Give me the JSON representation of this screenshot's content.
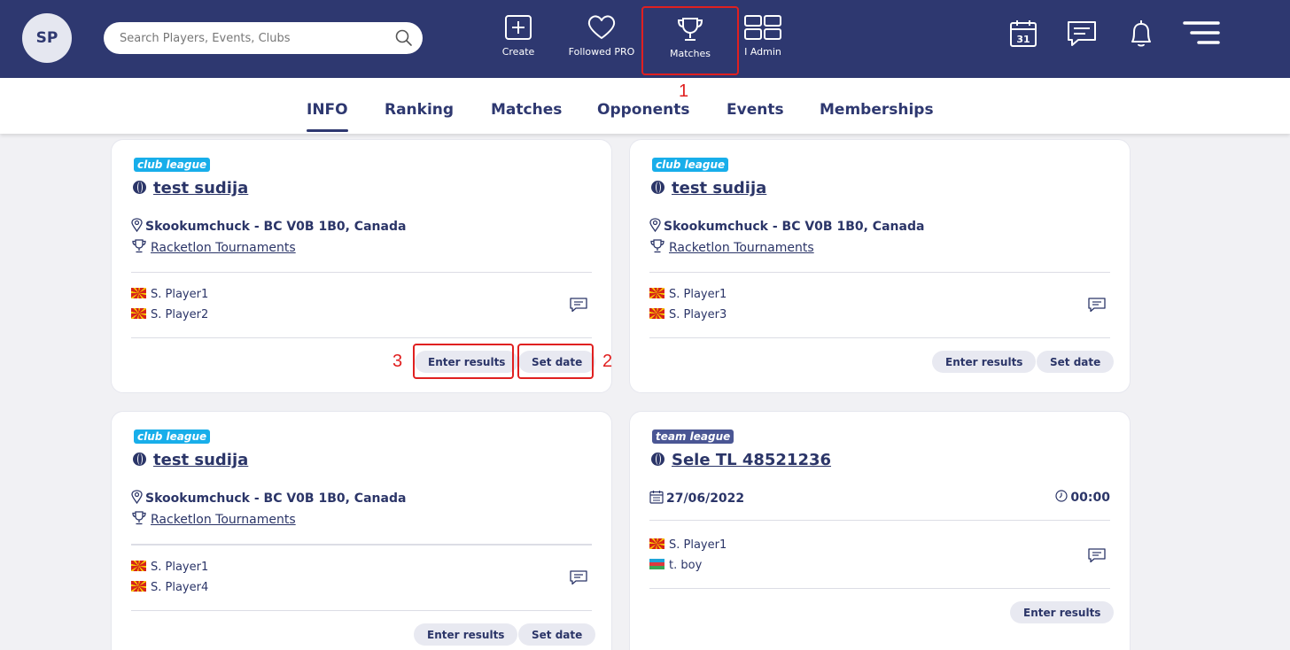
{
  "header": {
    "avatar_initials": "SP",
    "search_placeholder": "Search Players, Events, Clubs",
    "nav": [
      {
        "label": "Create",
        "icon": "plus-square-icon"
      },
      {
        "label": "Followed PRO",
        "icon": "heart-icon"
      },
      {
        "label": "Matches",
        "icon": "trophy-icon"
      },
      {
        "label": "I Admin",
        "icon": "grid-icon"
      }
    ],
    "right_icons": [
      "calendar-icon",
      "message-icon",
      "bell-icon",
      "menu-icon"
    ],
    "calendar_day": "31"
  },
  "tabs": [
    {
      "label": "INFO",
      "active": true
    },
    {
      "label": "Ranking"
    },
    {
      "label": "Matches"
    },
    {
      "label": "Opponents"
    },
    {
      "label": "Events"
    },
    {
      "label": "Memberships"
    }
  ],
  "annotations": [
    "1",
    "2",
    "3"
  ],
  "cards": [
    {
      "badge": "club league",
      "title": "test sudija",
      "location": "Skookumchuck - BC V0B 1B0, Canada",
      "event": "Racketlon Tournaments",
      "players": [
        "S. Player1",
        "S. Player2"
      ],
      "buttons": [
        "Enter results",
        "Set date"
      ]
    },
    {
      "badge": "club league",
      "title": "test sudija",
      "location": "Skookumchuck - BC V0B 1B0, Canada",
      "event": "Racketlon Tournaments",
      "players": [
        "S. Player1",
        "S. Player3"
      ],
      "buttons": [
        "Enter results",
        "Set date"
      ]
    },
    {
      "badge": "club league",
      "title": "test sudija",
      "location": "Skookumchuck - BC V0B 1B0, Canada",
      "event": "Racketlon Tournaments",
      "players": [
        "S. Player1",
        "S. Player4"
      ],
      "buttons": [
        "Enter results",
        "Set date"
      ]
    },
    {
      "badge": "team league",
      "title": "Sele TL 48521236",
      "date": "27/06/2022",
      "time": "00:00",
      "players": [
        "S. Player1",
        "t. boy"
      ],
      "buttons": [
        "Enter results"
      ]
    }
  ],
  "colors": {
    "header_bg": "#2e3870",
    "club_badge": "#18aeea",
    "team_badge": "#4a5694",
    "highlight": "#e02020"
  }
}
